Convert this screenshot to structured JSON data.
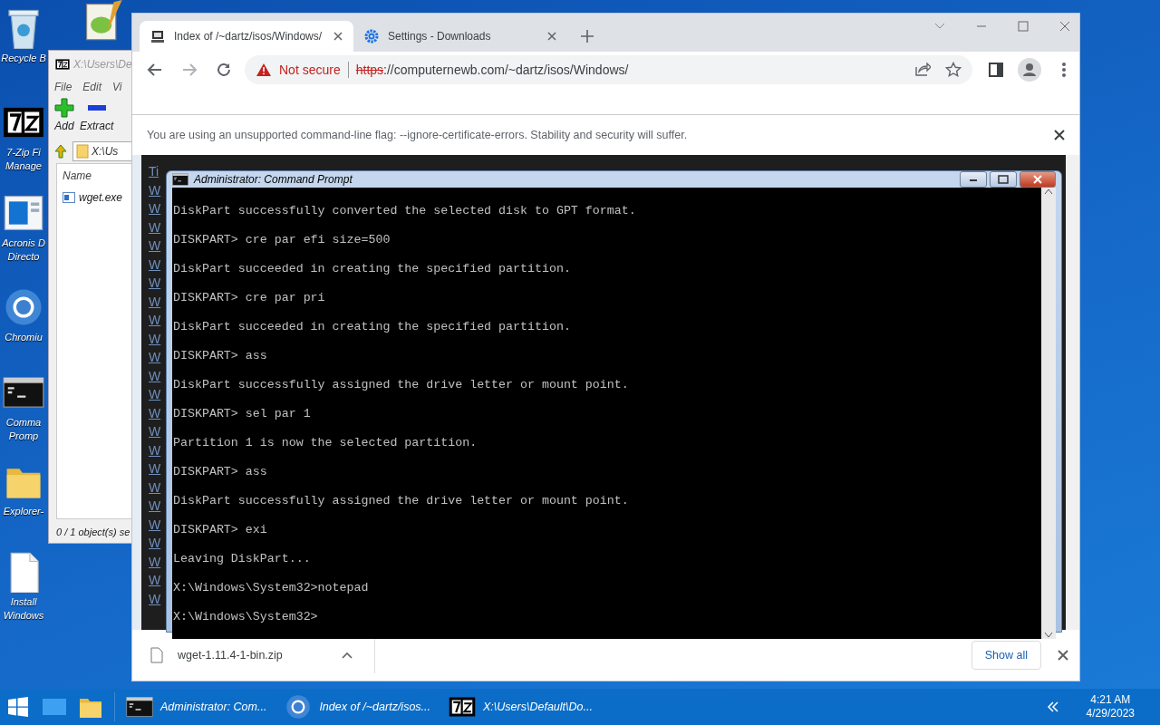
{
  "desktop_icons": [
    {
      "kind": "recycle",
      "label": [
        "Recycle B"
      ]
    },
    {
      "kind": "notepad"
    },
    {
      "kind": "sevenzip",
      "label": [
        "7-Zip Fi",
        "Manage"
      ]
    },
    {
      "kind": "acronis",
      "label": [
        "Acronis D",
        "Directo"
      ]
    },
    {
      "kind": "chromium",
      "label": [
        "Chromiu"
      ]
    },
    {
      "kind": "cmd",
      "label": [
        "Comma",
        "Promp"
      ]
    },
    {
      "kind": "explorer",
      "label": [
        "Explorer-"
      ]
    },
    {
      "kind": "install",
      "label": [
        "Install",
        "Windows"
      ]
    }
  ],
  "sevenzip_window": {
    "title": "X:\\Users\\De",
    "menu": [
      "File",
      "Edit",
      "Vi"
    ],
    "toolbar": [
      {
        "kind": "add",
        "label": "Add"
      },
      {
        "kind": "extract",
        "label": "Extract"
      }
    ],
    "path": "X:\\Us",
    "column": "Name",
    "files": [
      "wget.exe"
    ],
    "status": "0 / 1 object(s) se"
  },
  "browser": {
    "tabs": [
      {
        "kind": "page",
        "title": "Index of /~dartz/isos/Windows/",
        "selected": true
      },
      {
        "kind": "settings",
        "title": "Settings - Downloads",
        "selected": false
      }
    ],
    "not_secure": "Not secure",
    "url_scheme": "https",
    "url_rest": "://computernewb.com/~dartz/isos/Windows/",
    "infobar": "You are using an unsupported command-line flag: --ignore-certificate-errors. Stability and security will suffer.",
    "page_links": [
      "Ti",
      "W",
      "W",
      "W",
      "W",
      "W",
      "W",
      "W",
      "W",
      "W",
      "W",
      "W",
      "W",
      "W",
      "W",
      "W",
      "W",
      "W",
      "W",
      "W",
      "W",
      "W",
      "W",
      "W"
    ],
    "download": {
      "file": "wget-1.11.4-1-bin.zip",
      "show_all": "Show all"
    }
  },
  "cmd": {
    "title": "Administrator: Command Prompt",
    "lines": [
      "DiskPart successfully converted the selected disk to GPT format.",
      "DISKPART> cre par efi size=500",
      "DiskPart succeeded in creating the specified partition.",
      "DISKPART> cre par pri",
      "DiskPart succeeded in creating the specified partition.",
      "DISKPART> ass",
      "DiskPart successfully assigned the drive letter or mount point.",
      "DISKPART> sel par 1",
      "Partition 1 is now the selected partition.",
      "DISKPART> ass",
      "DiskPart successfully assigned the drive letter or mount point.",
      "DISKPART> exi",
      "Leaving DiskPart...",
      "X:\\Windows\\System32>notepad",
      "X:\\Windows\\System32>"
    ]
  },
  "taskbar": {
    "tasks": [
      {
        "kind": "cmd",
        "label": "Administrator: Com..."
      },
      {
        "kind": "chromium",
        "label": "Index of /~dartz/isos..."
      },
      {
        "kind": "sevenzip",
        "label": "X:\\Users\\Default\\Do..."
      }
    ],
    "clock_time": "4:21 AM",
    "clock_date": "4/29/2023"
  }
}
